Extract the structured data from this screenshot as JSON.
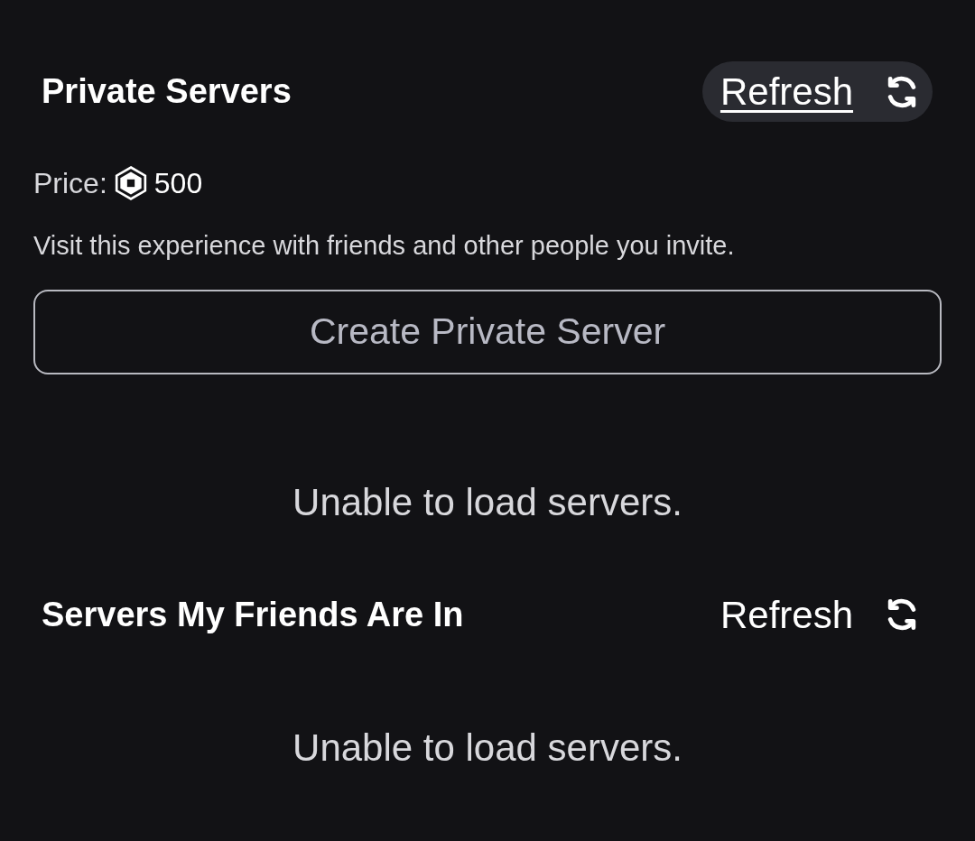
{
  "sections": [
    {
      "title": "Private Servers",
      "refresh": {
        "label": "Refresh",
        "focused": true
      },
      "price": {
        "label": "Price:",
        "amount": "500"
      },
      "description": "Visit this experience with friends and other people you invite.",
      "button": "Create Private Server",
      "message": "Unable to load servers."
    },
    {
      "title": "Servers My Friends Are In",
      "refresh": {
        "label": "Refresh",
        "focused": false
      },
      "message": "Unable to load servers."
    }
  ]
}
